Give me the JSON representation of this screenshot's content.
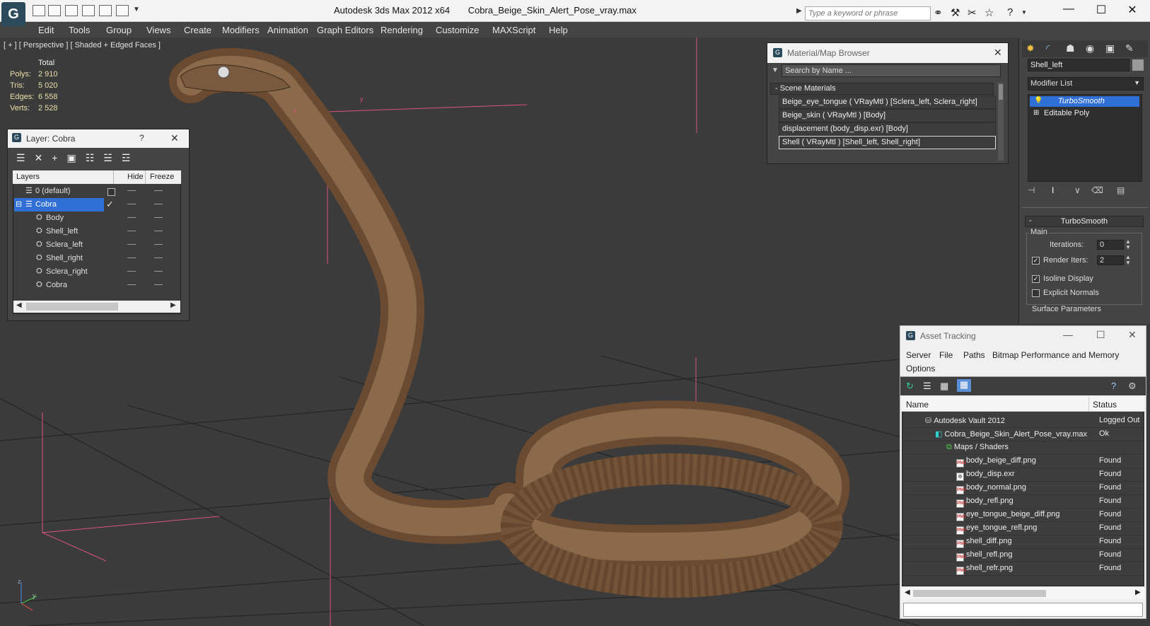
{
  "titlebar": {
    "app_title": "Autodesk 3ds Max  2012 x64",
    "file_name": "Cobra_Beige_Skin_Alert_Pose_vray.max",
    "search_placeholder": "Type a keyword or phrase",
    "logo_glyph": "G"
  },
  "menu": [
    "Edit",
    "Tools",
    "Group",
    "Views",
    "Create",
    "Modifiers",
    "Animation",
    "Graph Editors",
    "Rendering",
    "Customize",
    "MAXScript",
    "Help"
  ],
  "viewport": {
    "label": "[ + ] [ Perspective ] [ Shaded + Edged Faces ]",
    "stats": {
      "header": "Total",
      "rows": [
        {
          "label": "Polys:",
          "value": "2 910"
        },
        {
          "label": "Tris:",
          "value": "5 020"
        },
        {
          "label": "Edges:",
          "value": "6 558"
        },
        {
          "label": "Verts:",
          "value": "2 528"
        }
      ]
    },
    "axis_labels": {
      "x": "x",
      "y": "y",
      "z": "z"
    }
  },
  "layer_panel": {
    "title": "Layer: Cobra",
    "help": "?",
    "close": "✕",
    "columns": [
      "Layers",
      "Hide",
      "Freeze"
    ],
    "rows": [
      {
        "label": "0 (default)",
        "indent": 0,
        "kind": "layer"
      },
      {
        "label": "Cobra",
        "indent": 0,
        "kind": "layer",
        "selected": true
      },
      {
        "label": "Body",
        "indent": 1,
        "kind": "object"
      },
      {
        "label": "Shell_left",
        "indent": 1,
        "kind": "object"
      },
      {
        "label": "Sclera_left",
        "indent": 1,
        "kind": "object"
      },
      {
        "label": "Shell_right",
        "indent": 1,
        "kind": "object"
      },
      {
        "label": "Sclera_right",
        "indent": 1,
        "kind": "object"
      },
      {
        "label": "Cobra",
        "indent": 1,
        "kind": "object"
      }
    ]
  },
  "material_browser": {
    "title": "Material/Map Browser",
    "search_placeholder": "Search by Name ...",
    "section": "- Scene Materials",
    "items": [
      "Beige_eye_tongue  ( VRayMtl ) [Sclera_left, Sclera_right]",
      "Beige_skin  ( VRayMtl ) [Body]",
      "displacement (body_disp.exr) [Body]",
      "Shell  ( VRayMtl ) [Shell_left, Shell_right]"
    ]
  },
  "command_panel": {
    "object_name": "Shell_left",
    "modifier_list": "Modifier List",
    "stack": [
      "TurboSmooth",
      "Editable Poly"
    ],
    "rollout_title": "TurboSmooth",
    "group_main": "Main",
    "iterations_label": "Iterations:",
    "iterations_value": "0",
    "render_iters_label": "Render Iters:",
    "render_iters_value": "2",
    "isoline_label": "Isoline Display",
    "explicit_label": "Explicit Normals",
    "surface_label": "Surface Parameters"
  },
  "asset_tracking": {
    "title": "Asset Tracking",
    "menu_row1": [
      "Server",
      "File",
      "Paths",
      "Bitmap Performance and Memory"
    ],
    "menu_row2": [
      "Options"
    ],
    "columns": [
      "Name",
      "Status"
    ],
    "rows": [
      {
        "name": "Autodesk Vault 2012",
        "status": "Logged Out",
        "indent": 0,
        "icon": "vault"
      },
      {
        "name": "Cobra_Beige_Skin_Alert_Pose_vray.max",
        "status": "Ok",
        "indent": 1,
        "icon": "max"
      },
      {
        "name": "Maps / Shaders",
        "status": "",
        "indent": 2,
        "icon": "maps"
      },
      {
        "name": "body_beige_diff.png",
        "status": "Found",
        "indent": 3,
        "icon": "png"
      },
      {
        "name": "body_disp.exr",
        "status": "Found",
        "indent": 3,
        "icon": "exr"
      },
      {
        "name": "body_normal.png",
        "status": "Found",
        "indent": 3,
        "icon": "png"
      },
      {
        "name": "body_refl.png",
        "status": "Found",
        "indent": 3,
        "icon": "png"
      },
      {
        "name": "eye_tongue_beige_diff.png",
        "status": "Found",
        "indent": 3,
        "icon": "png"
      },
      {
        "name": "eye_tongue_refl.png",
        "status": "Found",
        "indent": 3,
        "icon": "png"
      },
      {
        "name": "shell_diff.png",
        "status": "Found",
        "indent": 3,
        "icon": "png"
      },
      {
        "name": "shell_refl.png",
        "status": "Found",
        "indent": 3,
        "icon": "png"
      },
      {
        "name": "shell_refr.png",
        "status": "Found",
        "indent": 3,
        "icon": "png"
      }
    ]
  },
  "colors": {
    "selection": "#2f6fd6",
    "grid_line": "#222222",
    "gizmo_pink": "#e0507a",
    "snake_brown": "#7a5a3e"
  }
}
